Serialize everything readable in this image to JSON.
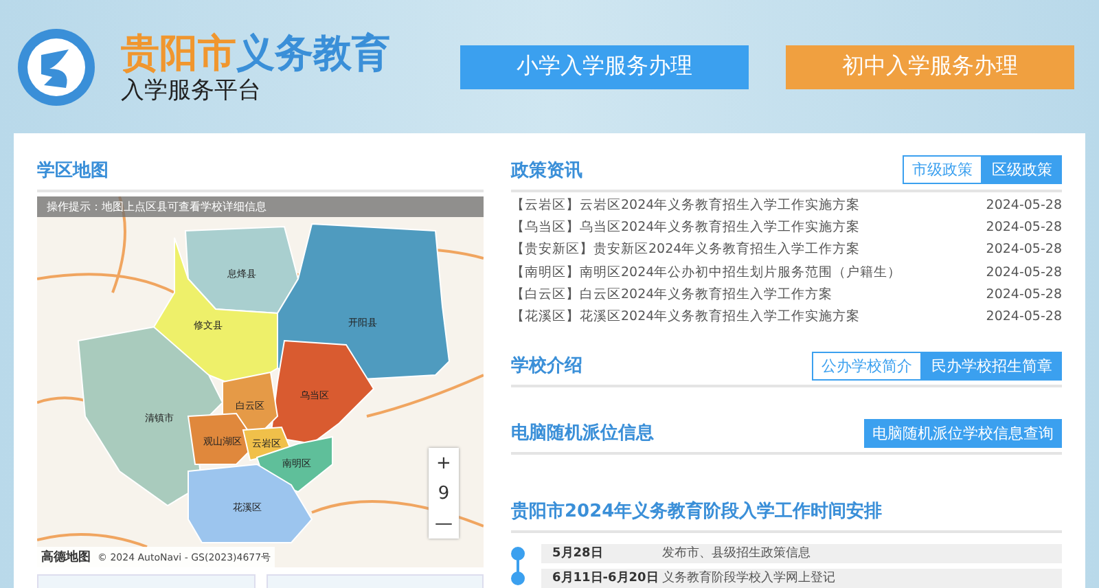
{
  "header": {
    "title": [
      {
        "text": "贵阳市",
        "color": "#f0962e"
      },
      {
        "text": "义务教育",
        "color": "#3a8fd8"
      }
    ],
    "subtitle": "入学服务平台",
    "buttons": [
      {
        "label": "小学入学服务办理",
        "color": "#3ba0ef"
      },
      {
        "label": "初中入学服务办理",
        "color": "#f0a040"
      }
    ]
  },
  "map_section": {
    "title": "学区地图",
    "hint": "操作提示：地图上点区县可查看学校详细信息",
    "zoom_in": "+",
    "zoom_level": "9",
    "zoom_out": "—",
    "attribution_logo": "高德地图",
    "attribution": "© 2024 AutoNavi - GS(2023)4677号",
    "districts": [
      {
        "name": "息烽县",
        "color": "#a9cfcf"
      },
      {
        "name": "开阳县",
        "color": "#4f9bbf"
      },
      {
        "name": "修文县",
        "color": "#eef06a"
      },
      {
        "name": "清镇市",
        "color": "#a9cbbd"
      },
      {
        "name": "乌当区",
        "color": "#d95b30"
      },
      {
        "name": "白云区",
        "color": "#e59a47"
      },
      {
        "name": "观山湖区",
        "color": "#e0883c"
      },
      {
        "name": "云岩区",
        "color": "#f0c04a"
      },
      {
        "name": "南明区",
        "color": "#5fbf9a"
      },
      {
        "name": "花溪区",
        "color": "#9cc5ee"
      }
    ]
  },
  "news": {
    "title": "政策资讯",
    "tabs": [
      {
        "label": "市级政策",
        "selected": false
      },
      {
        "label": "区级政策",
        "selected": true
      }
    ],
    "items": [
      {
        "title": "【云岩区】云岩区2024年义务教育招生入学工作实施方案",
        "date": "2024-05-28"
      },
      {
        "title": "【乌当区】乌当区2024年义务教育招生入学工作实施方案",
        "date": "2024-05-28"
      },
      {
        "title": "【贵安新区】贵安新区2024年义务教育招生入学工作方案",
        "date": "2024-05-28"
      },
      {
        "title": "【南明区】南明区2024年公办初中招生划片服务范围（户籍生）",
        "date": "2024-05-28"
      },
      {
        "title": "【白云区】白云区2024年义务教育招生入学工作方案",
        "date": "2024-05-28"
      },
      {
        "title": "【花溪区】花溪区2024年义务教育招生入学工作实施方案",
        "date": "2024-05-28"
      }
    ]
  },
  "schools": {
    "title": "学校介绍",
    "tabs": [
      {
        "label": "公办学校简介",
        "selected": false
      },
      {
        "label": "民办学校招生简章",
        "selected": true
      }
    ]
  },
  "lottery": {
    "title": "电脑随机派位信息",
    "button": "电脑随机派位学校信息查询"
  },
  "schedule": {
    "title": "贵阳市2024年义务教育阶段入学工作时间安排",
    "items": [
      {
        "date": "5月28日",
        "text": "发布市、县级招生政策信息"
      },
      {
        "date": "6月11日-6月20日",
        "text": "义务教育阶段学校入学网上登记"
      }
    ]
  }
}
